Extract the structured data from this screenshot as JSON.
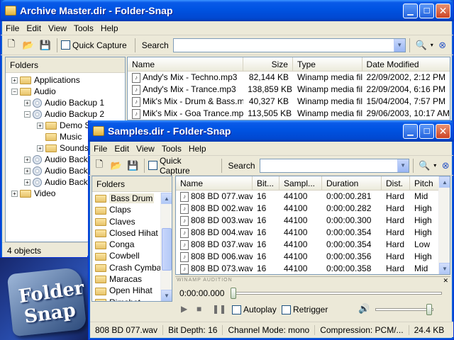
{
  "main_window": {
    "title": "Archive Master.dir - Folder-Snap",
    "menu": [
      "File",
      "Edit",
      "View",
      "Tools",
      "Help"
    ],
    "quick_capture": "Quick Capture",
    "search_label": "Search",
    "search_value": "",
    "folders_header": "Folders",
    "tree": [
      {
        "label": "Applications",
        "exp": "+",
        "indent": 0,
        "icon": "folder-icon"
      },
      {
        "label": "Audio",
        "exp": "−",
        "indent": 0,
        "icon": "folder-icon"
      },
      {
        "label": "Audio Backup 1",
        "exp": "+",
        "indent": 1,
        "icon": "cd-icon"
      },
      {
        "label": "Audio Backup 2",
        "exp": "−",
        "indent": 1,
        "icon": "cd-icon"
      },
      {
        "label": "Demo S",
        "exp": "+",
        "indent": 2,
        "icon": "folder-icon"
      },
      {
        "label": "Music",
        "exp": "",
        "indent": 2,
        "icon": "folder-icon"
      },
      {
        "label": "Sounds",
        "exp": "+",
        "indent": 2,
        "icon": "folder-icon"
      },
      {
        "label": "Audio Back",
        "exp": "+",
        "indent": 1,
        "icon": "cd-icon"
      },
      {
        "label": "Audio Back",
        "exp": "+",
        "indent": 1,
        "icon": "cd-icon"
      },
      {
        "label": "Audio Back",
        "exp": "+",
        "indent": 1,
        "icon": "cd-icon"
      },
      {
        "label": "Video",
        "exp": "+",
        "indent": 0,
        "icon": "folder-icon"
      }
    ],
    "columns": [
      "Name",
      "Size",
      "Type",
      "Date Modified"
    ],
    "rows": [
      [
        "Andy's Mix - Techno.mp3",
        "82,144 KB",
        "Winamp media file",
        "22/09/2002, 2:12 PM"
      ],
      [
        "Andy's Mix - Trance.mp3",
        "138,859 KB",
        "Winamp media file",
        "22/09/2004, 6:16 PM"
      ],
      [
        "Mik's Mix - Drum & Bass.mp3",
        "40,327 KB",
        "Winamp media file",
        "15/04/2004, 7:57 PM"
      ],
      [
        "Mik's Mix - Goa Trance.mp3",
        "113,505 KB",
        "Winamp media file",
        "29/06/2003, 10:17 AM"
      ]
    ],
    "status": "4 objects"
  },
  "logo": {
    "line1": "Folder",
    "line2": "Snap"
  },
  "samples_window": {
    "title": "Samples.dir - Folder-Snap",
    "menu": [
      "File",
      "Edit",
      "View",
      "Tools",
      "Help"
    ],
    "quick_capture": "Quick Capture",
    "search_label": "Search",
    "search_value": "",
    "folders_header": "Folders",
    "folders": [
      "Bass Drum",
      "Claps",
      "Claves",
      "Closed Hihat",
      "Conga",
      "Cowbell",
      "Crash Cymbal",
      "Maracas",
      "Open Hihat",
      "Rimshot"
    ],
    "selected_folder": "Bass Drum",
    "columns": [
      "Name",
      "Bit...",
      "Sampl...",
      "Duration",
      "Dist.",
      "Pitch"
    ],
    "rows": [
      [
        "808 BD 077.wav",
        "16",
        "44100",
        "0:00:00.281",
        "Hard",
        "Mid"
      ],
      [
        "808 BD 002.wav",
        "16",
        "44100",
        "0:00:00.282",
        "Hard",
        "High"
      ],
      [
        "808 BD 003.wav",
        "16",
        "44100",
        "0:00:00.300",
        "Hard",
        "High"
      ],
      [
        "808 BD 004.wav",
        "16",
        "44100",
        "0:00:00.354",
        "Hard",
        "High"
      ],
      [
        "808 BD 037.wav",
        "16",
        "44100",
        "0:00:00.354",
        "Hard",
        "Low"
      ],
      [
        "808 BD 006.wav",
        "16",
        "44100",
        "0:00:00.356",
        "Hard",
        "High"
      ],
      [
        "808 BD 073.wav",
        "16",
        "44100",
        "0:00:00.358",
        "Hard",
        "Mid"
      ]
    ],
    "player": {
      "title": "WINAMP AUDITION",
      "time": "0:00:00.000",
      "autoplay": "Autoplay",
      "retrigger": "Retrigger"
    },
    "status": {
      "file": "808 BD 077.wav",
      "bit_depth": "Bit Depth: 16",
      "channel": "Channel Mode: mono",
      "compression": "Compression: PCM/...",
      "size": "24.4 KB"
    }
  }
}
